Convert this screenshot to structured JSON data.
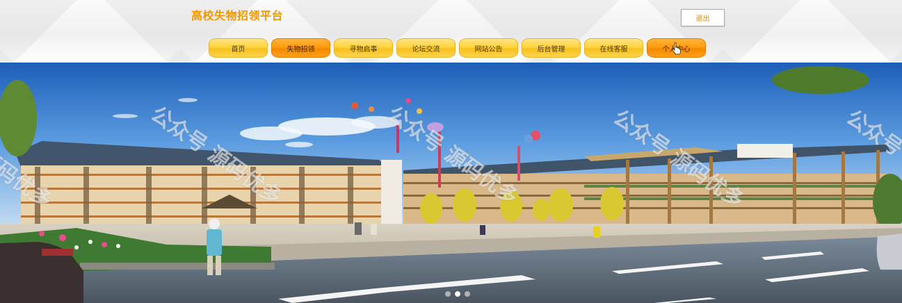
{
  "header": {
    "site_title": "高校失物招领平台",
    "logout_label": "退出"
  },
  "nav": {
    "items": [
      {
        "label": "首页",
        "active": false
      },
      {
        "label": "失物招领",
        "active": true
      },
      {
        "label": "寻物启事",
        "active": false
      },
      {
        "label": "论坛交流",
        "active": false
      },
      {
        "label": "网站公告",
        "active": false
      },
      {
        "label": "后台管理",
        "active": false
      },
      {
        "label": "在线客服",
        "active": false
      },
      {
        "label": "个人中心",
        "active": true
      }
    ]
  },
  "banner": {
    "watermark_text": "公众号 源码优多",
    "slide_count": 3,
    "active_slide": 2
  },
  "colors": {
    "brand": "#f39800",
    "nav_yellow": "#ffd43d",
    "nav_active": "#ff9d10"
  }
}
